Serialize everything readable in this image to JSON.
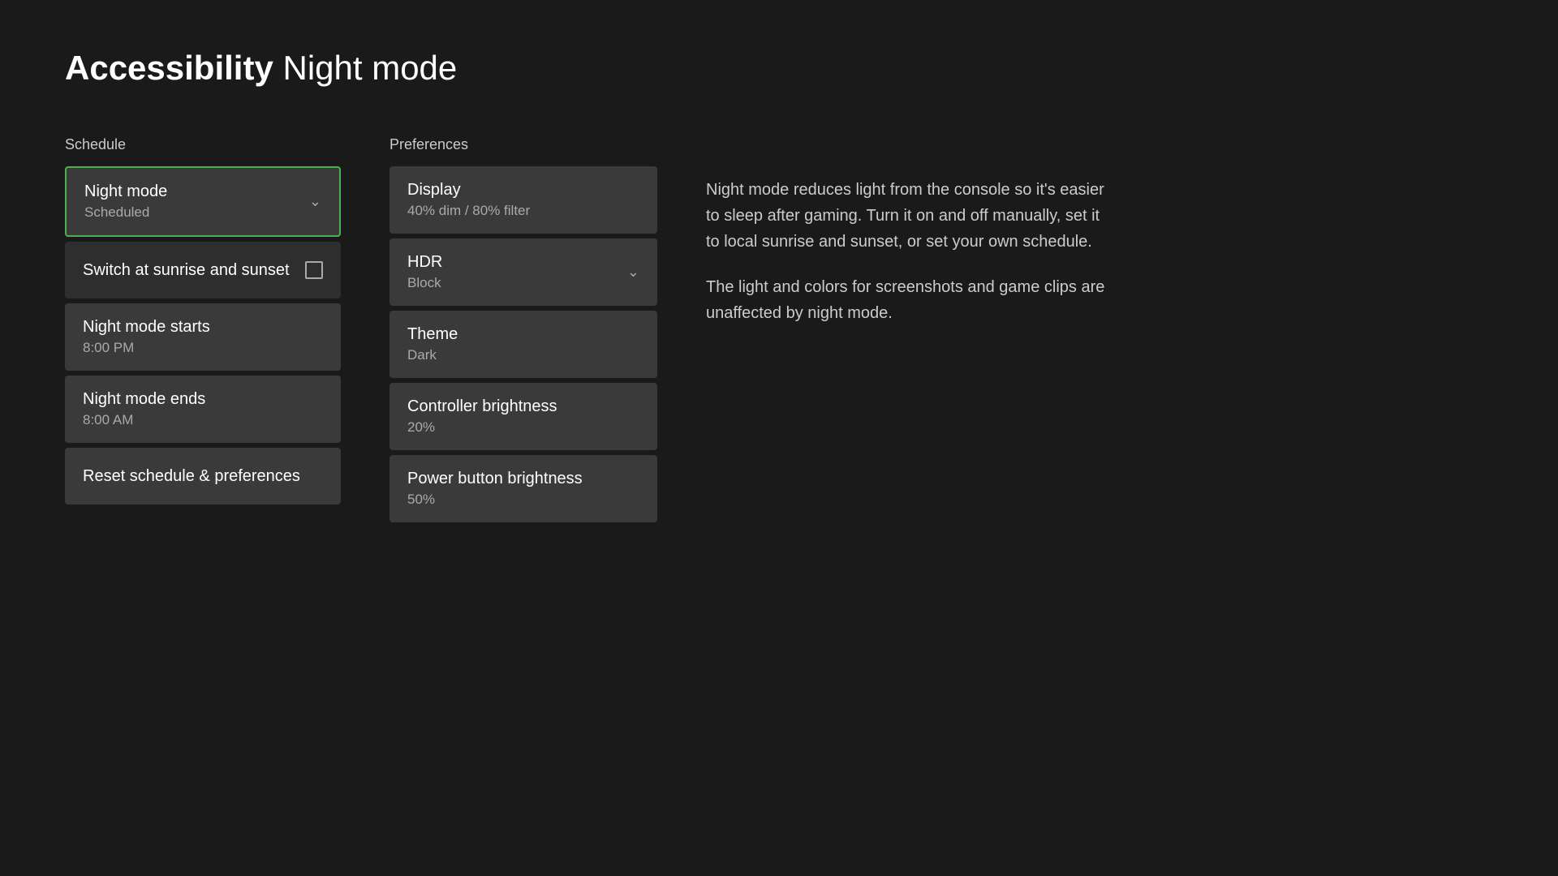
{
  "header": {
    "title_bold": "Accessibility",
    "title_light": "Night mode"
  },
  "schedule": {
    "section_label": "Schedule",
    "items": [
      {
        "id": "night-mode",
        "title": "Night mode",
        "subtitle": "Scheduled",
        "has_chevron": true,
        "selected": true
      },
      {
        "id": "switch-sunrise",
        "title": "Switch at sunrise and sunset",
        "subtitle": null,
        "has_checkbox": true,
        "selected": false
      },
      {
        "id": "night-mode-starts",
        "title": "Night mode starts",
        "subtitle": "8:00 PM",
        "has_chevron": false,
        "selected": false
      },
      {
        "id": "night-mode-ends",
        "title": "Night mode ends",
        "subtitle": "8:00 AM",
        "has_chevron": false,
        "selected": false
      },
      {
        "id": "reset",
        "title": "Reset schedule & preferences",
        "subtitle": null,
        "has_chevron": false,
        "selected": false
      }
    ]
  },
  "preferences": {
    "section_label": "Preferences",
    "items": [
      {
        "id": "display",
        "title": "Display",
        "subtitle": "40% dim / 80% filter",
        "has_chevron": false
      },
      {
        "id": "hdr",
        "title": "HDR",
        "subtitle": "Block",
        "has_chevron": true
      },
      {
        "id": "theme",
        "title": "Theme",
        "subtitle": "Dark",
        "has_chevron": false
      },
      {
        "id": "controller-brightness",
        "title": "Controller brightness",
        "subtitle": "20%",
        "has_chevron": false
      },
      {
        "id": "power-button-brightness",
        "title": "Power button brightness",
        "subtitle": "50%",
        "has_chevron": false
      }
    ]
  },
  "info": {
    "paragraph1": "Night mode reduces light from the console so it's easier to sleep after gaming. Turn it on and off manually, set it to local sunrise and sunset, or set your own schedule.",
    "paragraph2": "The light and colors for screenshots and game clips are unaffected by night mode."
  },
  "colors": {
    "selected_border": "#4caf50",
    "background": "#1a1a1a",
    "card_background": "#3a3a3a",
    "switch_background": "#2e2e2e"
  }
}
